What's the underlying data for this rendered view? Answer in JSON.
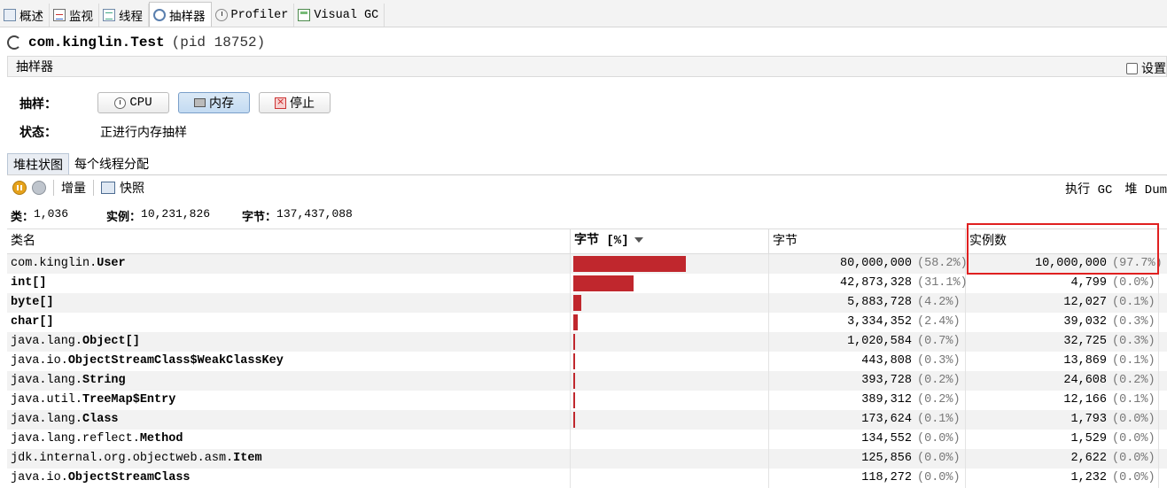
{
  "tabs": [
    {
      "label": "概述",
      "icon": "overview-icon"
    },
    {
      "label": "监视",
      "icon": "monitor-icon"
    },
    {
      "label": "线程",
      "icon": "threads-icon"
    },
    {
      "label": "抽样器",
      "icon": "sampler-icon"
    },
    {
      "label": "Profiler",
      "icon": "profiler-icon"
    },
    {
      "label": "Visual GC",
      "icon": "visual-gc-icon"
    }
  ],
  "app": {
    "name": "com.kinglin.Test",
    "pid": "(pid 18752)"
  },
  "sampler": {
    "header": "抽样器",
    "settings_label": "设置",
    "sample_label": "抽样：",
    "status_label": "状态：",
    "status_value": "正进行内存抽样",
    "buttons": {
      "cpu": "CPU",
      "memory": "内存",
      "stop": "停止"
    }
  },
  "inner_tabs": [
    "堆柱状图",
    "每个线程分配"
  ],
  "toolbar": {
    "delta": "增量",
    "snapshot": "快照",
    "gc": "执行 GC",
    "dump": "堆 Dum"
  },
  "summary": {
    "classes_label": "类：",
    "classes_value": "1,036",
    "instances_label": "实例：",
    "instances_value": "10,231,826",
    "bytes_label": "字节：",
    "bytes_value": "137,437,088"
  },
  "columns": {
    "name": "类名",
    "bytes_pct": "字节 [%]",
    "bytes": "字节",
    "instances": "实例数"
  },
  "rows": [
    {
      "pkg": "com.kinglin.",
      "cls": "User",
      "share": 0.582,
      "bytes": "80,000,000",
      "bytes_pct": "(58.2%)",
      "instances": "10,000,000",
      "inst_pct": "(97.7%)"
    },
    {
      "pkg": "",
      "cls": "int[]",
      "share": 0.311,
      "bytes": "42,873,328",
      "bytes_pct": "(31.1%)",
      "instances": "4,799",
      "inst_pct": "(0.0%)"
    },
    {
      "pkg": "",
      "cls": "byte[]",
      "share": 0.042,
      "bytes": "5,883,728",
      "bytes_pct": "(4.2%)",
      "instances": "12,027",
      "inst_pct": "(0.1%)"
    },
    {
      "pkg": "",
      "cls": "char[]",
      "share": 0.024,
      "bytes": "3,334,352",
      "bytes_pct": "(2.4%)",
      "instances": "39,032",
      "inst_pct": "(0.3%)"
    },
    {
      "pkg": "java.lang.",
      "cls": "Object[]",
      "share": 0.007,
      "bytes": "1,020,584",
      "bytes_pct": "(0.7%)",
      "instances": "32,725",
      "inst_pct": "(0.3%)"
    },
    {
      "pkg": "java.io.",
      "cls": "ObjectStreamClass$WeakClassKey",
      "share": 0.003,
      "bytes": "443,808",
      "bytes_pct": "(0.3%)",
      "instances": "13,869",
      "inst_pct": "(0.1%)"
    },
    {
      "pkg": "java.lang.",
      "cls": "String",
      "share": 0.002,
      "bytes": "393,728",
      "bytes_pct": "(0.2%)",
      "instances": "24,608",
      "inst_pct": "(0.2%)"
    },
    {
      "pkg": "java.util.",
      "cls": "TreeMap$Entry",
      "share": 0.002,
      "bytes": "389,312",
      "bytes_pct": "(0.2%)",
      "instances": "12,166",
      "inst_pct": "(0.1%)"
    },
    {
      "pkg": "java.lang.",
      "cls": "Class",
      "share": 0.001,
      "bytes": "173,624",
      "bytes_pct": "(0.1%)",
      "instances": "1,793",
      "inst_pct": "(0.0%)"
    },
    {
      "pkg": "java.lang.reflect.",
      "cls": "Method",
      "share": 0.0,
      "bytes": "134,552",
      "bytes_pct": "(0.0%)",
      "instances": "1,529",
      "inst_pct": "(0.0%)"
    },
    {
      "pkg": "jdk.internal.org.objectweb.asm.",
      "cls": "Item",
      "share": 0.0,
      "bytes": "125,856",
      "bytes_pct": "(0.0%)",
      "instances": "2,622",
      "inst_pct": "(0.0%)"
    },
    {
      "pkg": "java.io.",
      "cls": "ObjectStreamClass",
      "share": 0.0,
      "bytes": "118,272",
      "bytes_pct": "(0.0%)",
      "instances": "1,232",
      "inst_pct": "(0.0%)"
    }
  ],
  "colors": {
    "bar": "#c0272d",
    "highlight": "#e02020"
  }
}
